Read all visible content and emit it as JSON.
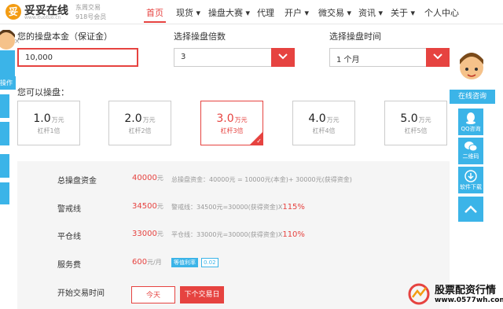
{
  "header": {
    "brand_name": "妥妥在线",
    "brand_url": "www.ituotuo.cn",
    "logo_char": "妥",
    "sub1": "东周交易",
    "sub2": "918号会员",
    "nav": [
      {
        "label": "首页"
      },
      {
        "label": "现货"
      },
      {
        "label": "操盘大赛"
      },
      {
        "label": "代理"
      },
      {
        "label": "开户"
      },
      {
        "label": "微交易"
      },
      {
        "label": "资讯"
      },
      {
        "label": "关于"
      },
      {
        "label": "个人中心"
      }
    ]
  },
  "form": {
    "principal_label": "您的操盘本金（保证金）",
    "principal_value": "10,000",
    "multiple_label": "选择操盘倍数",
    "multiple_value": "3",
    "duration_label": "选择操盘时间",
    "duration_value": "1 个月",
    "cards_title": "您可以操盘："
  },
  "cards": [
    {
      "amount": "1.0",
      "unit": "万元",
      "leverage": "杠杆1倍"
    },
    {
      "amount": "2.0",
      "unit": "万元",
      "leverage": "杠杆2倍"
    },
    {
      "amount": "3.0",
      "unit": "万元",
      "leverage": "杠杆3倍"
    },
    {
      "amount": "4.0",
      "unit": "万元",
      "leverage": "杠杆4倍"
    },
    {
      "amount": "5.0",
      "unit": "万元",
      "leverage": "杠杆5倍"
    }
  ],
  "summary": {
    "total_label": "总操盘资金",
    "total_value": "40000",
    "total_unit": "元",
    "total_note": "总操盘资金：40000元 = 10000元(本金)+ 30000元(获得资金)",
    "warn_label": "警戒线",
    "warn_value": "34500",
    "warn_unit": "元",
    "warn_note": "警戒线：34500元=30000(获得资金)X",
    "warn_pct": "115%",
    "close_label": "平仓线",
    "close_value": "33000",
    "close_unit": "元",
    "close_note": "平仓线：33000元=30000(获得资金)X",
    "close_pct": "110%",
    "fee_label": "服务费",
    "fee_value": "600",
    "fee_unit": "元/月",
    "fee_badge": "等值利率",
    "fee_rate": "0.02",
    "start_label": "开始交易时间",
    "today_btn": "今天",
    "next_btn": "下个交易日"
  },
  "sidebar_left": {
    "tab": "操作"
  },
  "sidebar_right": {
    "title": "在线咨询",
    "qq": "QQ咨询",
    "qr": "二维码",
    "download": "软件下载"
  },
  "watermark": {
    "title": "股票配资行情",
    "url": "www.0577wh.com"
  },
  "colors": {
    "accent": "#e64340",
    "side": "#3bb4e8"
  }
}
